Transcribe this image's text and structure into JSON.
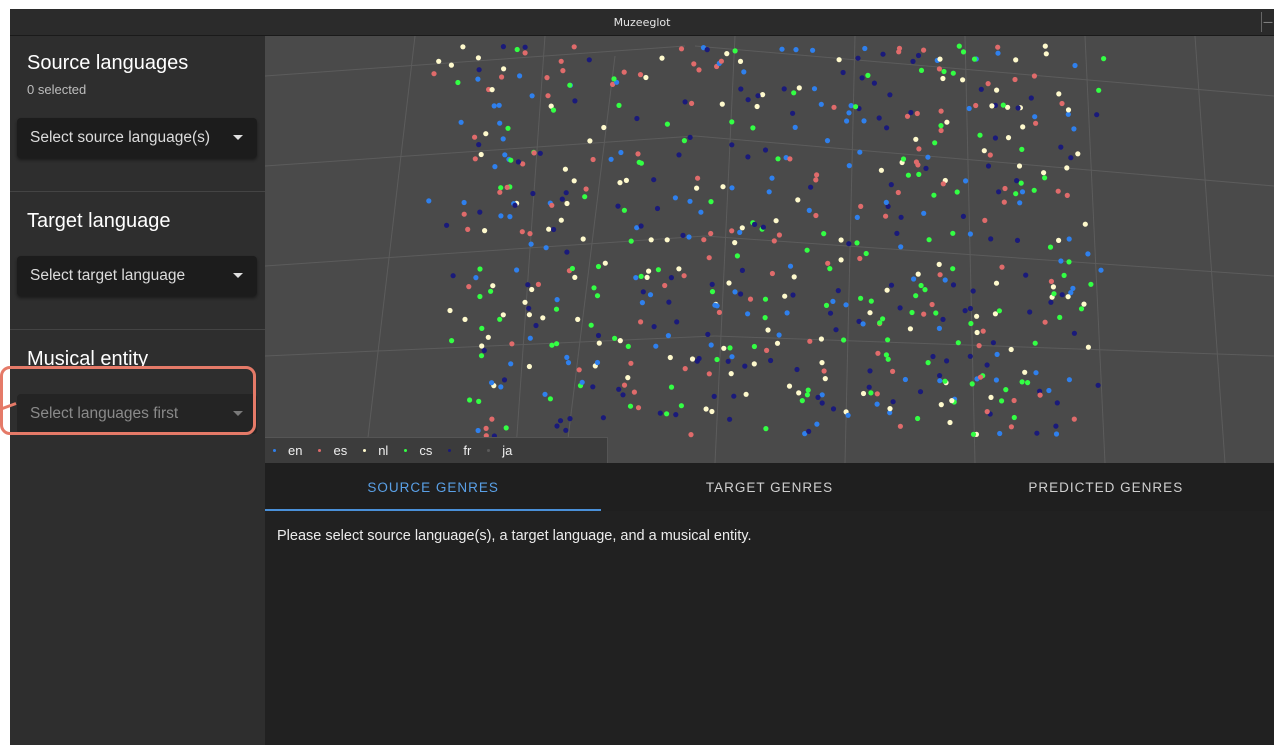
{
  "window": {
    "title": "Muzeeglot",
    "control_glyph": "—"
  },
  "sidebar": {
    "source": {
      "title": "Source languages",
      "count": "0 selected",
      "select_label": "Select source language(s)"
    },
    "target": {
      "title": "Target language",
      "select_label": "Select target language"
    },
    "entity": {
      "title": "Musical entity",
      "select_label": "Select languages first"
    }
  },
  "legend": [
    {
      "code": "en",
      "color": "#2f80ed"
    },
    {
      "code": "es",
      "color": "#e06b6b"
    },
    {
      "code": "nl",
      "color": "#fffacd"
    },
    {
      "code": "cs",
      "color": "#33ff44"
    },
    {
      "code": "fr",
      "color": "#1a1a7a"
    },
    {
      "code": "ja",
      "color": "#5a5a5a"
    }
  ],
  "tabs": [
    {
      "label": "SOURCE GENRES",
      "active": true
    },
    {
      "label": "TARGET GENRES",
      "active": false
    },
    {
      "label": "PREDICTED GENRES",
      "active": false
    }
  ],
  "message": "Please select source language(s), a target language, and a musical entity."
}
